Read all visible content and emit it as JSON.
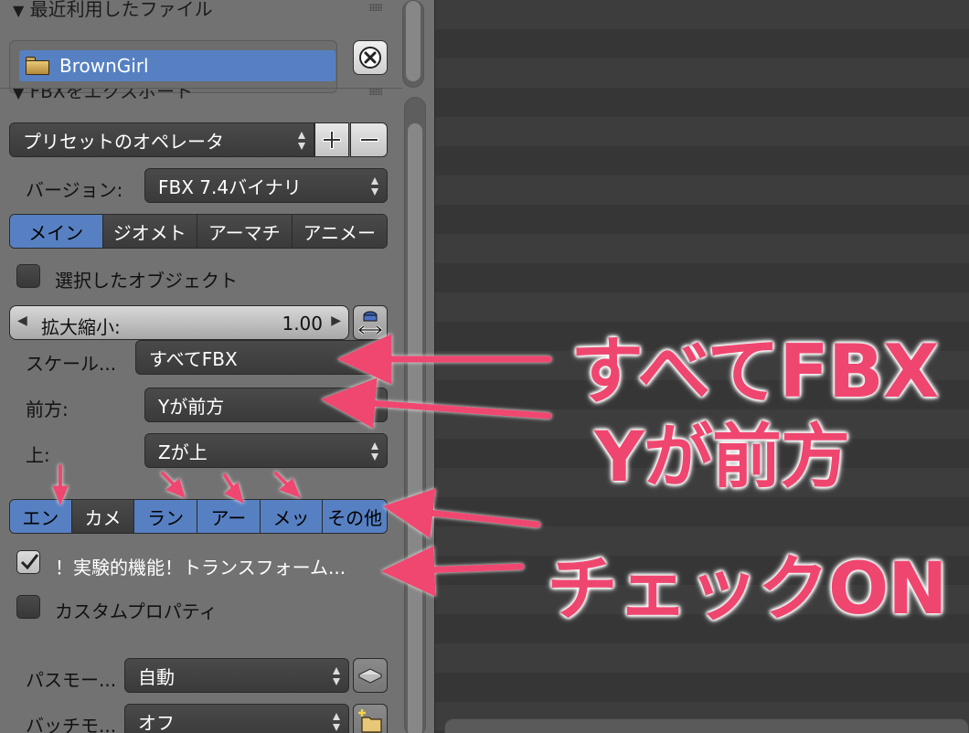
{
  "panel": {
    "recent_header": "最近利用したファイル",
    "recent_file": "BrownGirl",
    "fbx_header": "FBXをエクスポート"
  },
  "preset": {
    "label": "プリセットのオペレータ"
  },
  "version": {
    "label": "バージョン:",
    "value": "FBX 7.4バイナリ"
  },
  "main_tabs": [
    {
      "label": "メイン",
      "active": true
    },
    {
      "label": "ジオメト",
      "active": false
    },
    {
      "label": "アーマチ",
      "active": false
    },
    {
      "label": "アニメー",
      "active": false
    }
  ],
  "selected_objects": {
    "label": "選択したオブジェクト",
    "checked": false
  },
  "scale": {
    "label": "拡大縮小:",
    "value": "1.00"
  },
  "apply_scaling": {
    "label": "スケール...",
    "value": "すべてFBX"
  },
  "forward": {
    "label": "前方:",
    "value": "Yが前方"
  },
  "up": {
    "label": "上:",
    "value": "Zが上"
  },
  "type_tabs": [
    {
      "label": "エン",
      "active": true
    },
    {
      "label": "カメ",
      "active": false
    },
    {
      "label": "ラン",
      "active": true
    },
    {
      "label": "アー",
      "active": true
    },
    {
      "label": "メッ",
      "active": true
    },
    {
      "label": "その他",
      "active": true
    }
  ],
  "experimental": {
    "label": "！実験的機能！トランスフォーム...",
    "checked": true
  },
  "custom_props": {
    "label": "カスタムプロパティ",
    "checked": false
  },
  "path_mode": {
    "label": "パスモー...",
    "value": "自動"
  },
  "batch_mode": {
    "label": "バッチモ...",
    "value": "オフ"
  },
  "annotations": {
    "all_fbx": "すべてFBX",
    "y_forward": "Yが前方",
    "check_on": "チェックON",
    "color": "#ef466f"
  }
}
